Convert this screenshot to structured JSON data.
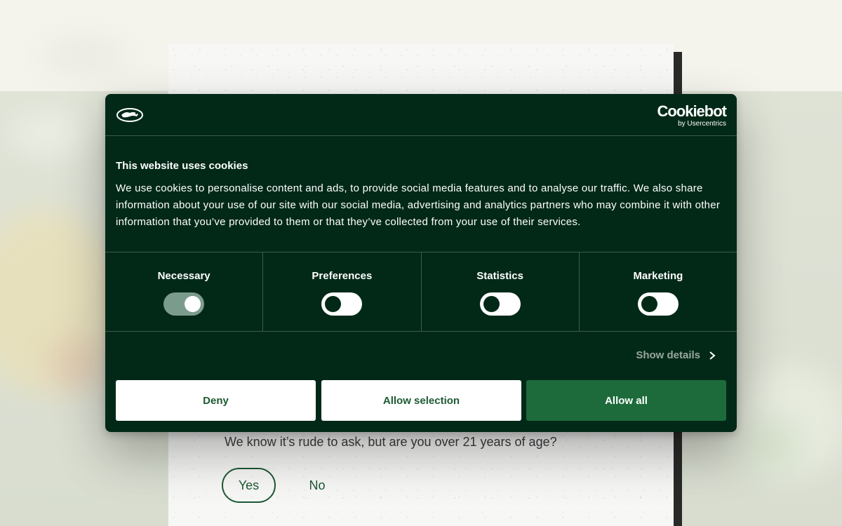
{
  "age_gate": {
    "question": "We know it’s rude to ask, but are you over 21 years of age?",
    "yes_label": "Yes",
    "no_label": "No"
  },
  "cookie_dialog": {
    "brand": {
      "name": "Cookiebot",
      "byline": "by Usercentrics"
    },
    "title": "This website uses cookies",
    "body": "We use cookies to personalise content and ads, to provide social media features and to analyse our traffic. We also share information about your use of our site with our social media, advertising and analytics partners who may combine it with other information that you’ve provided to them or that they’ve collected from your use of their services.",
    "categories": [
      {
        "label": "Necessary",
        "enabled": true
      },
      {
        "label": "Preferences",
        "enabled": false
      },
      {
        "label": "Statistics",
        "enabled": false
      },
      {
        "label": "Marketing",
        "enabled": false
      }
    ],
    "show_details_label": "Show details",
    "buttons": {
      "deny": "Deny",
      "allow_selection": "Allow selection",
      "allow_all": "Allow all"
    },
    "colors": {
      "background": "#022918",
      "accent": "#1d6b3b",
      "toggle_on": "#7b9c8c"
    }
  }
}
